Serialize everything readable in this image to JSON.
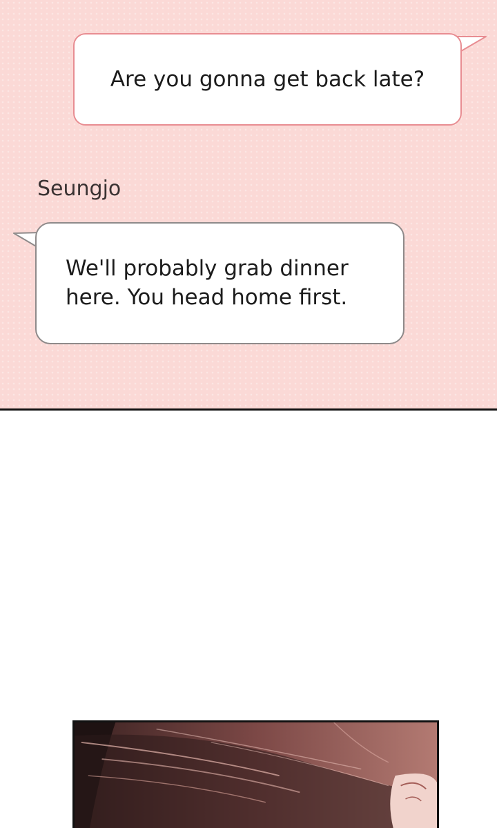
{
  "conversation": {
    "outgoing_message": {
      "text": "Are you gonna get back late?"
    },
    "incoming_message": {
      "sender": "Seungjo",
      "lines": [
        "We'll probably grab dinner",
        "here. You head home first."
      ]
    }
  },
  "colors": {
    "chat_background": "#fbd9d6",
    "outgoing_border": "#e88d92",
    "incoming_border": "#8e8a8a",
    "panel_border": "#111111"
  },
  "illustration": {
    "icon": "hair-closeup-illustration"
  }
}
